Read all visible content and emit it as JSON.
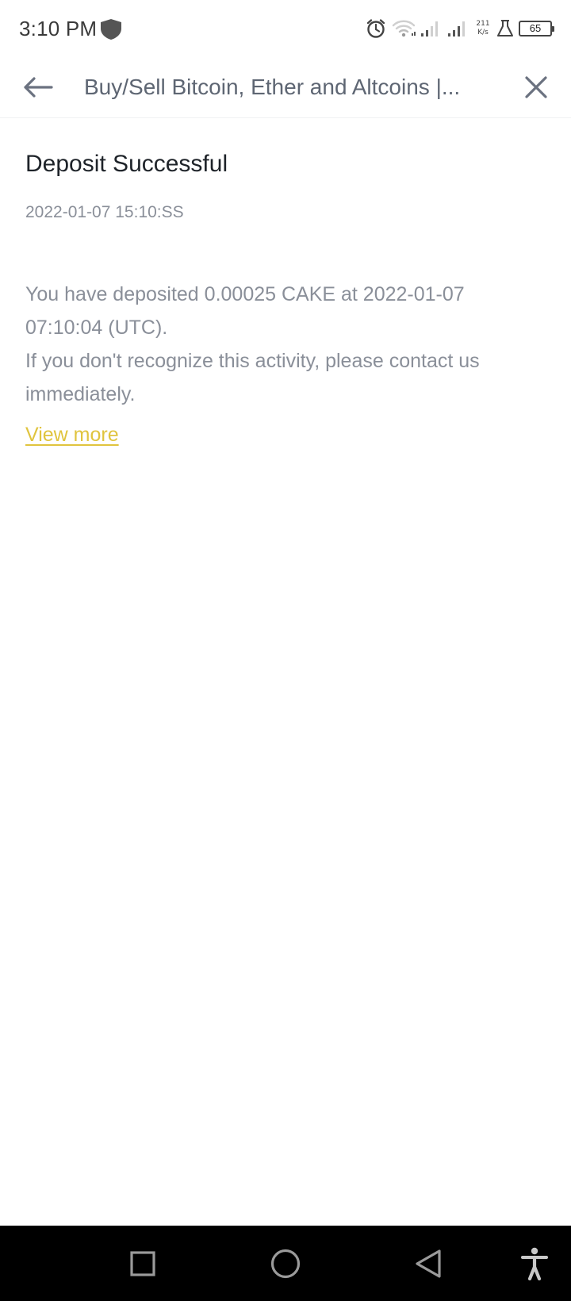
{
  "status_bar": {
    "time": "3:10 PM",
    "net_speed_value": "211",
    "net_speed_unit": "K/s",
    "battery": "65",
    "icons": [
      "shield-icon",
      "alarm-icon",
      "wifi-icon",
      "signal-icon",
      "signal-icon",
      "flask-icon",
      "battery-icon"
    ]
  },
  "header": {
    "title": "Buy/Sell Bitcoin, Ether and Altcoins |...",
    "back_icon": "arrow-left-icon",
    "close_icon": "close-icon"
  },
  "notification": {
    "title": "Deposit Successful",
    "timestamp": "2022-01-07 15:10:SS",
    "message_line1": "You have deposited 0.00025 CAKE at 2022-01-07 07:10:04 (UTC).",
    "message_line2": "If you don't recognize this activity, please contact us immediately.",
    "link_label": "View more"
  },
  "nav_bar": {
    "icons": [
      "recents-icon",
      "home-icon",
      "back-icon",
      "accessibility-icon"
    ]
  },
  "colors": {
    "link": "#e0c43e",
    "title_text": "#1e2329",
    "secondary_text": "#8a8f99",
    "header_text": "#5e6673",
    "nav_background": "#000000"
  }
}
